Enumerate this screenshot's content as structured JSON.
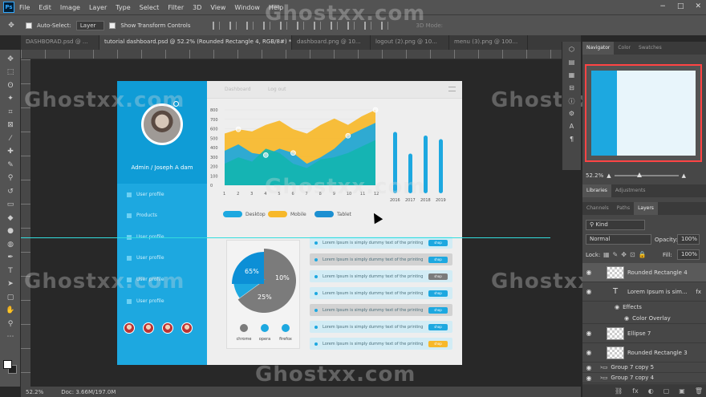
{
  "menu": {
    "logo": "Ps",
    "items": [
      "File",
      "Edit",
      "Image",
      "Layer",
      "Type",
      "Select",
      "Filter",
      "3D",
      "View",
      "Window",
      "Help"
    ],
    "window_controls": [
      "−",
      "□",
      "✕"
    ]
  },
  "options": {
    "auto_select_label": "Auto-Select:",
    "auto_select_value": "Layer",
    "transform_controls_label": "Show Transform Controls",
    "mode_3d_label": "3D Mode:"
  },
  "tabs": [
    {
      "label": "DASHBORAD.psd @ ..."
    },
    {
      "label": "tutorial dashboard.psd @ 52.2% (Rounded Rectangle 4, RGB/8#) *"
    },
    {
      "label": "dashboard.png @ 10..."
    },
    {
      "label": "logout (2).png @ 10..."
    },
    {
      "label": "menu (3).png @ 100..."
    }
  ],
  "status": {
    "zoom": "52.2%",
    "doc": "Doc: 3.66M/197.0M"
  },
  "watermark": "Ghostxx.com",
  "dashboard": {
    "username": "Admin / Joseph A dam",
    "topbar": {
      "dashboard": "Dashboard",
      "logout": "Log out"
    },
    "menu": [
      "User profile",
      "Products",
      "User profile",
      "User profile",
      "User profile",
      "User profile"
    ],
    "legend": [
      {
        "label": "Desktop",
        "color": "#1da8e0"
      },
      {
        "label": "Mobile",
        "color": "#f7b82a"
      },
      {
        "label": "Tablet",
        "color": "#1c8fd1"
      }
    ],
    "pie": {
      "slices": [
        {
          "label": "65%",
          "value": 65,
          "color": "#7b7b7b"
        },
        {
          "label": "10%",
          "value": 10,
          "color": "#1da8e0"
        },
        {
          "label": "25%",
          "value": 25,
          "color": "#0c8fd6"
        }
      ],
      "legend": [
        {
          "label": "chrome",
          "color": "#7b7b7b"
        },
        {
          "label": "opera",
          "color": "#1da8e0"
        },
        {
          "label": "firefox",
          "color": "#1da8e0"
        }
      ]
    },
    "rows": [
      {
        "text": "Lorem Ipsum is simply dummy text of the printing",
        "button": "shop",
        "bg": "#d2ecf5",
        "btn": "#1da8e0"
      },
      {
        "text": "Lorem Ipsum is simply dummy text of the printing",
        "button": "shop",
        "bg": "#d2d2d2",
        "btn": "#1da8e0"
      },
      {
        "text": "Lorem Ipsum is simply dummy text of the printing",
        "button": "shop",
        "bg": "#d2ecf5",
        "btn": "#7b7b7b"
      },
      {
        "text": "Lorem Ipsum is simply dummy text of the printing",
        "button": "shop",
        "bg": "#d2ecf5",
        "btn": "#1da8e0"
      },
      {
        "text": "Lorem Ipsum is simply dummy text of the printing",
        "button": "shop",
        "bg": "#d2d2d2",
        "btn": "#1da8e0"
      },
      {
        "text": "Lorem Ipsum is simply dummy text of the printing",
        "button": "shop",
        "bg": "#d2ecf5",
        "btn": "#1da8e0"
      },
      {
        "text": "Lorem Ipsum is simply dummy text of the printing",
        "button": "shop",
        "bg": "#d2ecf5",
        "btn": "#f7b82a"
      }
    ]
  },
  "chart_data": [
    {
      "type": "area",
      "x": [
        1,
        2,
        3,
        4,
        5,
        6,
        7,
        8,
        9,
        10,
        11,
        12
      ],
      "ylim": [
        0,
        700
      ],
      "yticks": [
        0,
        100,
        200,
        300,
        400,
        500,
        600,
        700,
        800
      ],
      "series": [
        {
          "name": "Mobile",
          "color": "#f7b82a",
          "values": [
            480,
            520,
            500,
            560,
            600,
            520,
            480,
            560,
            620,
            560,
            640,
            700
          ]
        },
        {
          "name": "Desktop",
          "color": "#1da8e0",
          "values": [
            320,
            380,
            300,
            280,
            340,
            300,
            200,
            260,
            340,
            460,
            520,
            580
          ]
        },
        {
          "name": "Tablet",
          "color": "#14b5b0",
          "values": [
            200,
            260,
            220,
            340,
            300,
            200,
            160,
            240,
            260,
            300,
            360,
            420
          ]
        }
      ]
    },
    {
      "type": "bar",
      "categories": [
        "2016",
        "2017",
        "2018",
        "2019"
      ],
      "values": [
        85,
        55,
        80,
        75
      ],
      "ylim": [
        0,
        100
      ]
    }
  ],
  "right_panel": {
    "nav_tabs": [
      "Navigator",
      "Color",
      "Swatches"
    ],
    "zoom": "52.2%",
    "lib_tabs": [
      "Libraries",
      "Adjustments"
    ],
    "layer_tabs": [
      "Channels",
      "Paths",
      "Layers"
    ],
    "kind": "Kind",
    "blend": "Normal",
    "opacity_label": "Opacity:",
    "opacity": "100%",
    "lock_label": "Lock:",
    "fill_label": "Fill:",
    "fill": "100%",
    "layers": [
      {
        "name": "Rounded Rectangle 4",
        "sel": true
      },
      {
        "name": "Lorem Ipsum is sim...",
        "sel": false,
        "type": "T"
      },
      {
        "name": "Effects",
        "sel": false
      },
      {
        "name": "Color Overlay",
        "sel": false
      },
      {
        "name": "Ellipse 7",
        "sel": false
      },
      {
        "name": "Rounded Rectangle 3",
        "sel": false
      },
      {
        "name": "Group 7 copy 5",
        "sel": false
      },
      {
        "name": "Group 7 copy 4",
        "sel": false
      }
    ],
    "bottom_icons": [
      "fx",
      "◐",
      "▢",
      "▣",
      "🗑"
    ]
  }
}
